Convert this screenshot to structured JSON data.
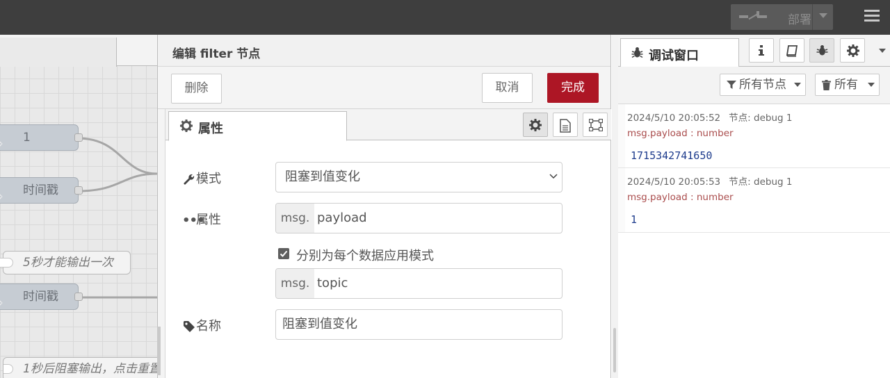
{
  "header": {
    "deploy_label": "部署"
  },
  "workspace": {
    "nodes": [
      {
        "label": "1"
      },
      {
        "label": "时间戳"
      },
      {
        "label": "时间戳"
      }
    ],
    "comments": [
      {
        "label": "5秒才能输出一次"
      },
      {
        "label": "1秒后阻塞输出，点击重置"
      }
    ]
  },
  "editor": {
    "title": "编辑 filter 节点",
    "delete_label": "删除",
    "cancel_label": "取消",
    "done_label": "完成",
    "tab_properties": "属性",
    "mode_label": "模式",
    "mode_value": "阻塞到值变化",
    "property_label": "属性",
    "property_prefix": "msg.",
    "property_value": "payload",
    "separate_checkbox_label": "分别为每个数据应用模式",
    "separate_checked": true,
    "topic_prefix": "msg.",
    "topic_value": "topic",
    "name_label": "名称",
    "name_value": "阻塞到值变化"
  },
  "sidebar": {
    "tab_debug": "调试窗口",
    "filter_nodes_label": "所有节点",
    "clear_label": "所有",
    "messages": [
      {
        "timestamp": "2024/5/10 20:05:52",
        "node": "节点: debug 1",
        "path": "msg.payload : number",
        "value": "1715342741650"
      },
      {
        "timestamp": "2024/5/10 20:05:53",
        "node": "节点: debug 1",
        "path": "msg.payload : number",
        "value": "1"
      }
    ]
  },
  "colors": {
    "header_bg": "#3e3e3e",
    "primary_button": "#ad1625",
    "debug_path": "#aa4d4d",
    "debug_value": "#1d3b8c"
  }
}
